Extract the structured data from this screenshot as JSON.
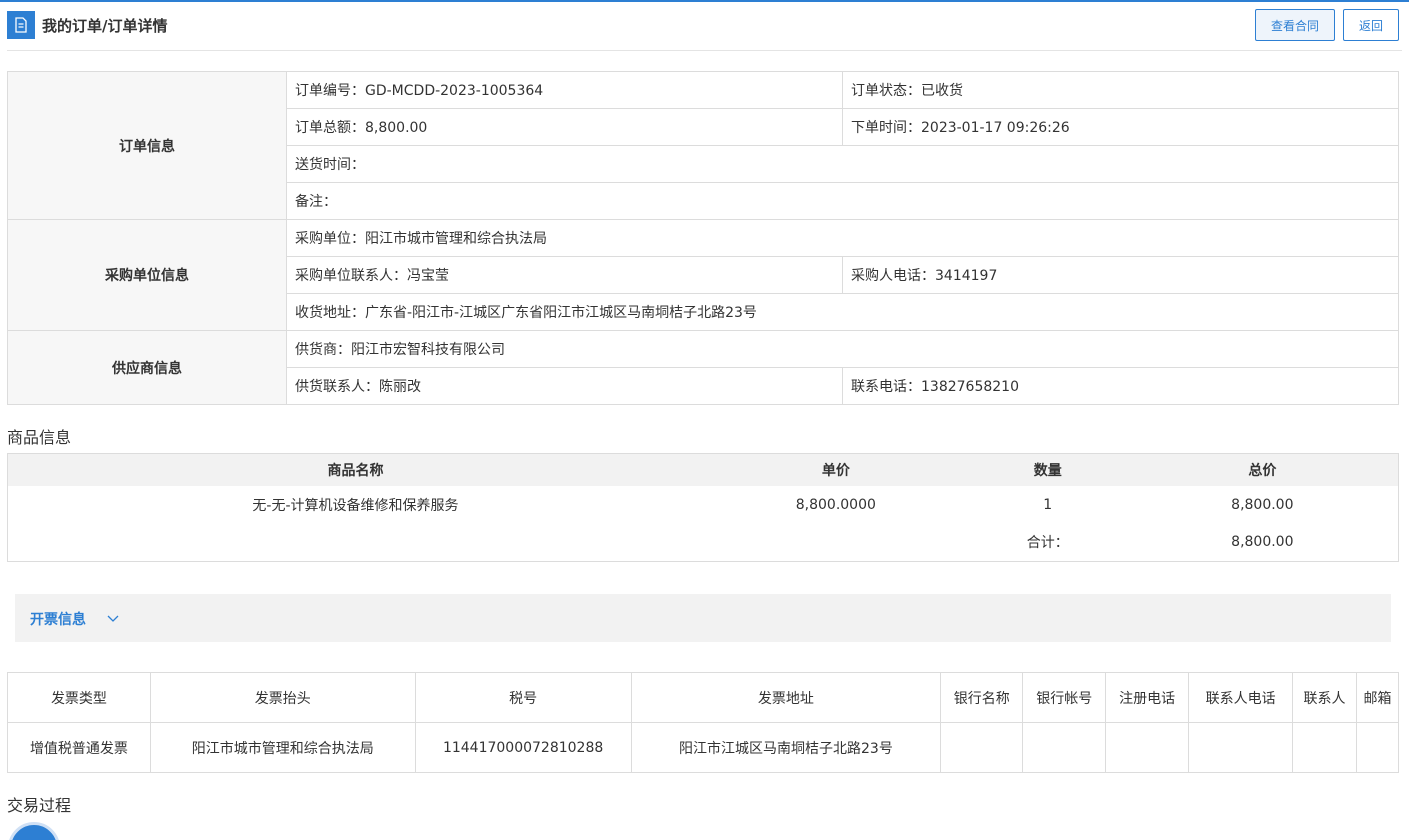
{
  "header": {
    "title": "我的订单/订单详情",
    "view_contract_label": "查看合同",
    "back_label": "返回"
  },
  "order_info": {
    "section_label": "订单信息",
    "order_no": "订单编号：GD-MCDD-2023-1005364",
    "status": "订单状态：已收货",
    "total": "订单总额：8,800.00",
    "order_time": "下单时间：2023-01-17 09:26:26",
    "delivery_time": "送货时间：",
    "remark": "备注："
  },
  "buyer_info": {
    "section_label": "采购单位信息",
    "unit": "采购单位：阳江市城市管理和综合执法局",
    "contact": "采购单位联系人：冯宝莹",
    "phone": "采购人电话：3414197",
    "address": "收货地址：广东省-阳江市-江城区广东省阳江市江城区马南垌桔子北路23号"
  },
  "supplier_info": {
    "section_label": "供应商信息",
    "supplier": "供货商：阳江市宏智科技有限公司",
    "contact": "供货联系人：陈丽改",
    "phone": "联系电话：13827658210"
  },
  "goods": {
    "section_label": "商品信息",
    "columns": [
      "商品名称",
      "单价",
      "数量",
      "总价"
    ],
    "rows": [
      {
        "name": "无-无-计算机设备维修和保养服务",
        "unit_price": "8,800.0000",
        "qty": "1",
        "total": "8,800.00"
      }
    ],
    "sum_label": "合计：",
    "sum_value": "8,800.00"
  },
  "invoice": {
    "section_label": "开票信息",
    "columns": [
      "发票类型",
      "发票抬头",
      "税号",
      "发票地址",
      "银行名称",
      "银行帐号",
      "注册电话",
      "联系人电话",
      "联系人",
      "邮箱"
    ],
    "rows": [
      {
        "type": "增值税普通发票",
        "title": "阳江市城市管理和综合执法局",
        "tax_no": "114417000072810288",
        "address": "阳江市江城区马南垌桔子北路23号",
        "bank": "",
        "account": "",
        "reg_phone": "",
        "contact_phone": "",
        "contact": "",
        "email": ""
      }
    ]
  },
  "transaction": {
    "section_label": "交易过程"
  },
  "colors": {
    "accent": "#2d7fd3",
    "border": "#dcdcdc",
    "header_bg": "#f2f2f2"
  }
}
